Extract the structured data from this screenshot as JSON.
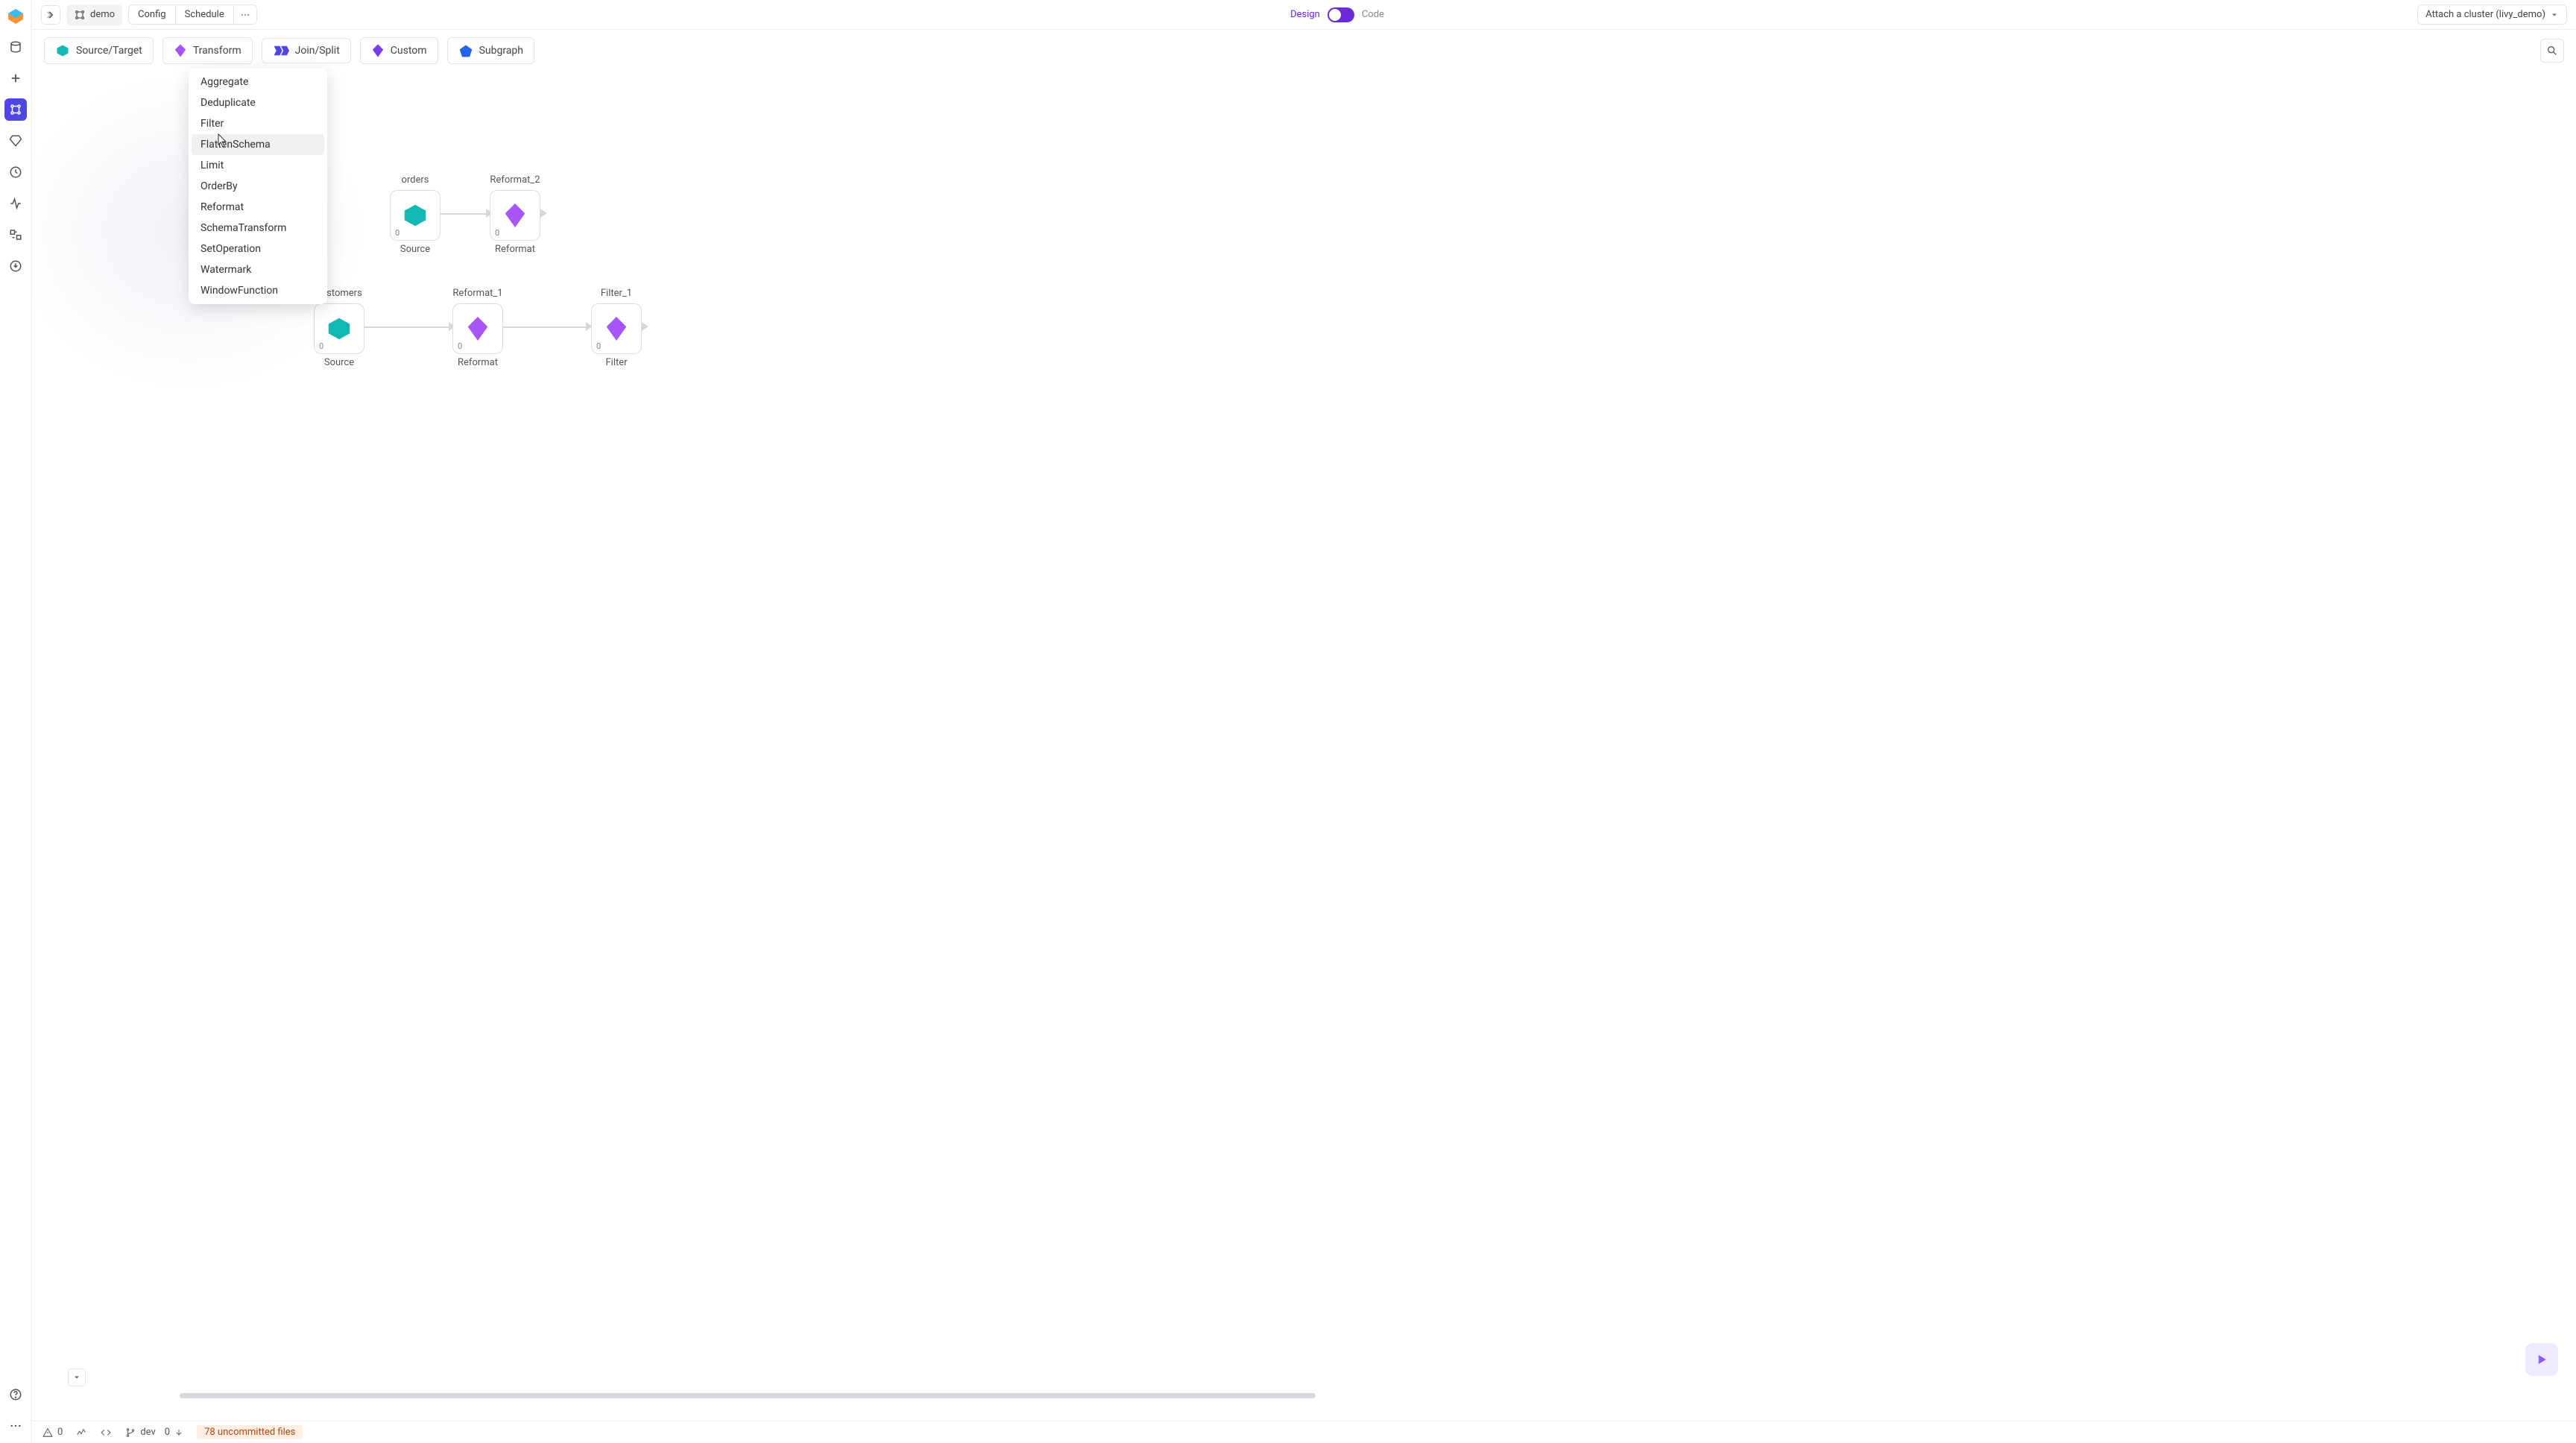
{
  "pipeline_name": "demo",
  "segmented": {
    "config": "Config",
    "schedule": "Schedule"
  },
  "mode": {
    "design": "Design",
    "code": "Code"
  },
  "cluster_button": "Attach a cluster (livy_demo)",
  "gembar": {
    "source_target": "Source/Target",
    "transform": "Transform",
    "join_split": "Join/Split",
    "custom": "Custom",
    "subgraph": "Subgraph"
  },
  "transform_menu": [
    "Aggregate",
    "Deduplicate",
    "Filter",
    "FlattenSchema",
    "Limit",
    "OrderBy",
    "Reformat",
    "SchemaTransform",
    "SetOperation",
    "Watermark",
    "WindowFunction"
  ],
  "transform_menu_hover_index": 3,
  "nodes": {
    "orders": {
      "title": "orders",
      "sub": "Source",
      "count": "0"
    },
    "reformat2": {
      "title": "Reformat_2",
      "sub": "Reformat",
      "count": "0"
    },
    "customers": {
      "title": "customers",
      "sub": "Source",
      "count": "0"
    },
    "reformat1": {
      "title": "Reformat_1",
      "sub": "Reformat",
      "count": "0"
    },
    "filter1": {
      "title": "Filter_1",
      "sub": "Filter",
      "count": "0"
    }
  },
  "status": {
    "errors": "0",
    "branch": "dev",
    "behind": "0",
    "uncommitted": "78 uncommitted files"
  }
}
